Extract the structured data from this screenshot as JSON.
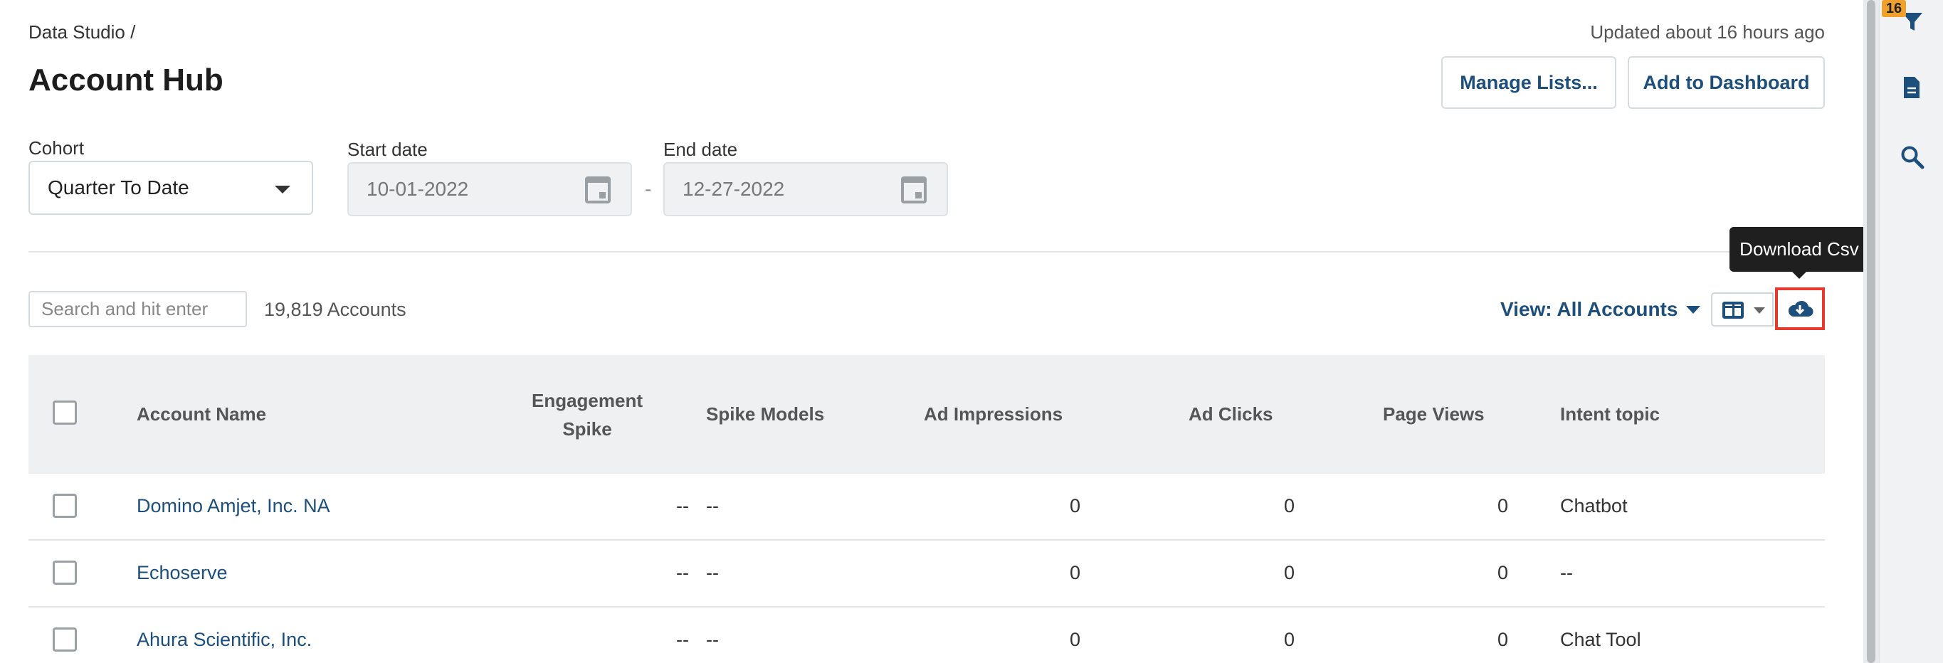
{
  "breadcrumb": "Data Studio /",
  "updated_text": "Updated about 16 hours ago",
  "page_title": "Account Hub",
  "buttons": {
    "manage_lists": "Manage Lists...",
    "add_to_dashboard": "Add to Dashboard"
  },
  "filters": {
    "cohort": {
      "label": "Cohort",
      "value": "Quarter To Date"
    },
    "start_date": {
      "label": "Start date",
      "value": "10-01-2022"
    },
    "separator": "-",
    "end_date": {
      "label": "End date",
      "value": "12-27-2022"
    }
  },
  "toolbar": {
    "search_placeholder": "Search and hit enter",
    "account_count": "19,819 Accounts",
    "view_label": "View: All Accounts",
    "download_tooltip": "Download Csv"
  },
  "table": {
    "headers": {
      "account_name": "Account Name",
      "engagement_spike_line1": "Engagement",
      "engagement_spike_line2": "Spike",
      "spike_models": "Spike Models",
      "ad_impressions": "Ad Impressions",
      "ad_clicks": "Ad Clicks",
      "page_views": "Page Views",
      "intent_topic": "Intent topic"
    },
    "rows": [
      {
        "name": "Domino Amjet, Inc. NA",
        "engagement_spike": "--",
        "spike_models": "--",
        "ad_impressions": "0",
        "ad_clicks": "0",
        "page_views": "0",
        "intent_topic": "Chatbot"
      },
      {
        "name": "Echoserve",
        "engagement_spike": "--",
        "spike_models": "--",
        "ad_impressions": "0",
        "ad_clicks": "0",
        "page_views": "0",
        "intent_topic": "--"
      },
      {
        "name": "Ahura Scientific, Inc.",
        "engagement_spike": "--",
        "spike_models": "--",
        "ad_impressions": "0",
        "ad_clicks": "0",
        "page_views": "0",
        "intent_topic": "Chat Tool"
      }
    ]
  },
  "right_rail": {
    "filter_badge": "16",
    "icons": [
      "filter-icon",
      "document-icon",
      "search-icon"
    ]
  },
  "colors": {
    "accent": "#1d4f7c",
    "highlight": "#e53b2f",
    "badge": "#f0a12b",
    "table_header_bg": "#eff0f2"
  }
}
